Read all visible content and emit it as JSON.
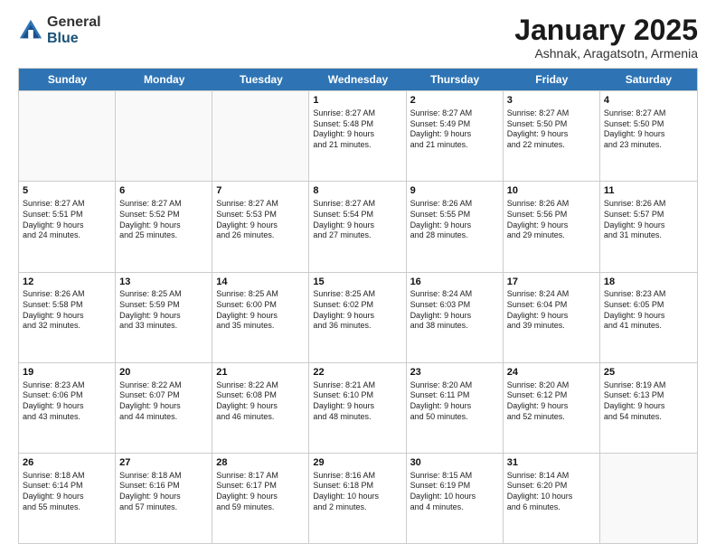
{
  "logo": {
    "general": "General",
    "blue": "Blue"
  },
  "title": "January 2025",
  "location": "Ashnak, Aragatsotn, Armenia",
  "days": [
    "Sunday",
    "Monday",
    "Tuesday",
    "Wednesday",
    "Thursday",
    "Friday",
    "Saturday"
  ],
  "weeks": [
    [
      {
        "day": "",
        "info": ""
      },
      {
        "day": "",
        "info": ""
      },
      {
        "day": "",
        "info": ""
      },
      {
        "day": "1",
        "info": "Sunrise: 8:27 AM\nSunset: 5:48 PM\nDaylight: 9 hours\nand 21 minutes."
      },
      {
        "day": "2",
        "info": "Sunrise: 8:27 AM\nSunset: 5:49 PM\nDaylight: 9 hours\nand 21 minutes."
      },
      {
        "day": "3",
        "info": "Sunrise: 8:27 AM\nSunset: 5:50 PM\nDaylight: 9 hours\nand 22 minutes."
      },
      {
        "day": "4",
        "info": "Sunrise: 8:27 AM\nSunset: 5:50 PM\nDaylight: 9 hours\nand 23 minutes."
      }
    ],
    [
      {
        "day": "5",
        "info": "Sunrise: 8:27 AM\nSunset: 5:51 PM\nDaylight: 9 hours\nand 24 minutes."
      },
      {
        "day": "6",
        "info": "Sunrise: 8:27 AM\nSunset: 5:52 PM\nDaylight: 9 hours\nand 25 minutes."
      },
      {
        "day": "7",
        "info": "Sunrise: 8:27 AM\nSunset: 5:53 PM\nDaylight: 9 hours\nand 26 minutes."
      },
      {
        "day": "8",
        "info": "Sunrise: 8:27 AM\nSunset: 5:54 PM\nDaylight: 9 hours\nand 27 minutes."
      },
      {
        "day": "9",
        "info": "Sunrise: 8:26 AM\nSunset: 5:55 PM\nDaylight: 9 hours\nand 28 minutes."
      },
      {
        "day": "10",
        "info": "Sunrise: 8:26 AM\nSunset: 5:56 PM\nDaylight: 9 hours\nand 29 minutes."
      },
      {
        "day": "11",
        "info": "Sunrise: 8:26 AM\nSunset: 5:57 PM\nDaylight: 9 hours\nand 31 minutes."
      }
    ],
    [
      {
        "day": "12",
        "info": "Sunrise: 8:26 AM\nSunset: 5:58 PM\nDaylight: 9 hours\nand 32 minutes."
      },
      {
        "day": "13",
        "info": "Sunrise: 8:25 AM\nSunset: 5:59 PM\nDaylight: 9 hours\nand 33 minutes."
      },
      {
        "day": "14",
        "info": "Sunrise: 8:25 AM\nSunset: 6:00 PM\nDaylight: 9 hours\nand 35 minutes."
      },
      {
        "day": "15",
        "info": "Sunrise: 8:25 AM\nSunset: 6:02 PM\nDaylight: 9 hours\nand 36 minutes."
      },
      {
        "day": "16",
        "info": "Sunrise: 8:24 AM\nSunset: 6:03 PM\nDaylight: 9 hours\nand 38 minutes."
      },
      {
        "day": "17",
        "info": "Sunrise: 8:24 AM\nSunset: 6:04 PM\nDaylight: 9 hours\nand 39 minutes."
      },
      {
        "day": "18",
        "info": "Sunrise: 8:23 AM\nSunset: 6:05 PM\nDaylight: 9 hours\nand 41 minutes."
      }
    ],
    [
      {
        "day": "19",
        "info": "Sunrise: 8:23 AM\nSunset: 6:06 PM\nDaylight: 9 hours\nand 43 minutes."
      },
      {
        "day": "20",
        "info": "Sunrise: 8:22 AM\nSunset: 6:07 PM\nDaylight: 9 hours\nand 44 minutes."
      },
      {
        "day": "21",
        "info": "Sunrise: 8:22 AM\nSunset: 6:08 PM\nDaylight: 9 hours\nand 46 minutes."
      },
      {
        "day": "22",
        "info": "Sunrise: 8:21 AM\nSunset: 6:10 PM\nDaylight: 9 hours\nand 48 minutes."
      },
      {
        "day": "23",
        "info": "Sunrise: 8:20 AM\nSunset: 6:11 PM\nDaylight: 9 hours\nand 50 minutes."
      },
      {
        "day": "24",
        "info": "Sunrise: 8:20 AM\nSunset: 6:12 PM\nDaylight: 9 hours\nand 52 minutes."
      },
      {
        "day": "25",
        "info": "Sunrise: 8:19 AM\nSunset: 6:13 PM\nDaylight: 9 hours\nand 54 minutes."
      }
    ],
    [
      {
        "day": "26",
        "info": "Sunrise: 8:18 AM\nSunset: 6:14 PM\nDaylight: 9 hours\nand 55 minutes."
      },
      {
        "day": "27",
        "info": "Sunrise: 8:18 AM\nSunset: 6:16 PM\nDaylight: 9 hours\nand 57 minutes."
      },
      {
        "day": "28",
        "info": "Sunrise: 8:17 AM\nSunset: 6:17 PM\nDaylight: 9 hours\nand 59 minutes."
      },
      {
        "day": "29",
        "info": "Sunrise: 8:16 AM\nSunset: 6:18 PM\nDaylight: 10 hours\nand 2 minutes."
      },
      {
        "day": "30",
        "info": "Sunrise: 8:15 AM\nSunset: 6:19 PM\nDaylight: 10 hours\nand 4 minutes."
      },
      {
        "day": "31",
        "info": "Sunrise: 8:14 AM\nSunset: 6:20 PM\nDaylight: 10 hours\nand 6 minutes."
      },
      {
        "day": "",
        "info": ""
      }
    ]
  ]
}
